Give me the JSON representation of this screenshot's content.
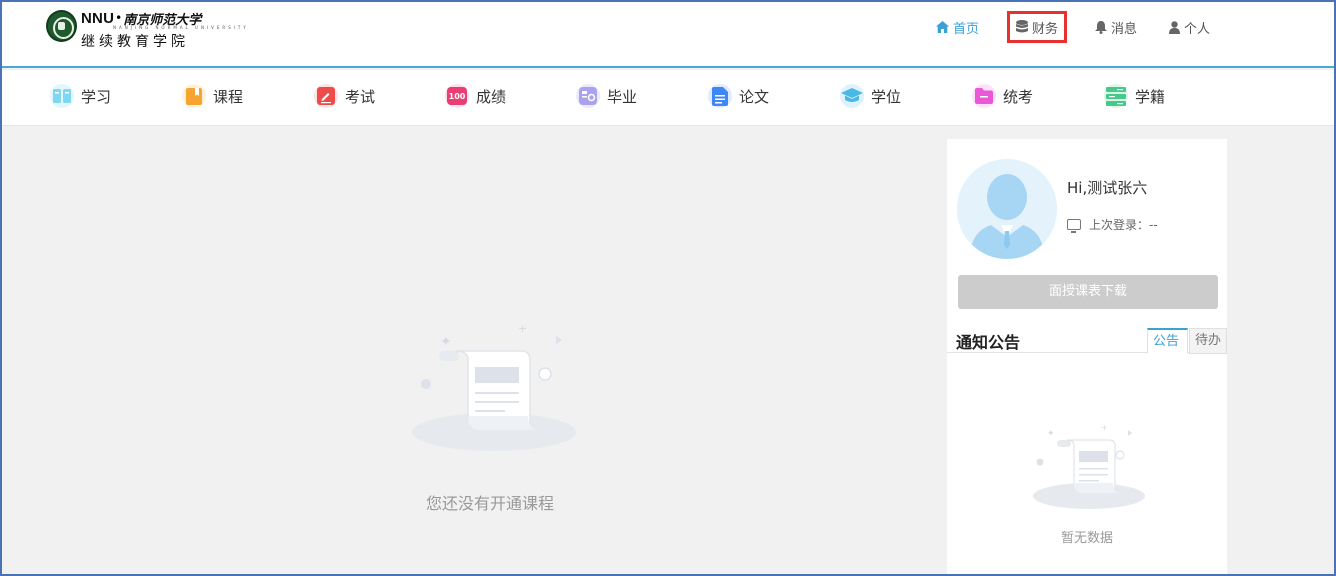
{
  "header": {
    "logo": {
      "brand_en": "NNU",
      "brand_cn": "南京师范大学",
      "english_line": "NANJING NORMAL UNIVERSITY",
      "subtitle": "继续教育学院"
    },
    "nav": [
      {
        "label": "首页",
        "icon": "home-icon",
        "active": true
      },
      {
        "label": "财务",
        "icon": "database-icon",
        "highlighted": true
      },
      {
        "label": "消息",
        "icon": "bell-icon"
      },
      {
        "label": "个人",
        "icon": "user-icon"
      }
    ]
  },
  "modules": [
    {
      "label": "学习",
      "icon": "book-open-icon",
      "color": "#7fd8f0"
    },
    {
      "label": "课程",
      "icon": "bookmark-icon",
      "color": "#f7a531"
    },
    {
      "label": "考试",
      "icon": "pencil-icon",
      "color": "#ef4b4b"
    },
    {
      "label": "成绩",
      "icon": "score-100-icon",
      "color": "#e83e73"
    },
    {
      "label": "毕业",
      "icon": "certificate-icon",
      "color": "#a9a3ee"
    },
    {
      "label": "论文",
      "icon": "document-icon",
      "color": "#3f87f5"
    },
    {
      "label": "学位",
      "icon": "graduation-cap-icon",
      "color": "#4ab8e6"
    },
    {
      "label": "统考",
      "icon": "folder-icon",
      "color": "#ea58d8"
    },
    {
      "label": "学籍",
      "icon": "server-list-icon",
      "color": "#47c98a"
    }
  ],
  "main": {
    "empty_text": "您还没有开通课程"
  },
  "profile": {
    "greeting": "Hi,测试张六",
    "last_login": "上次登录：--",
    "download_button": "面授课表下载"
  },
  "notice": {
    "title": "通知公告",
    "tabs": [
      "公告",
      "待办"
    ],
    "active_tab": "公告",
    "empty_text": "暂无数据"
  }
}
